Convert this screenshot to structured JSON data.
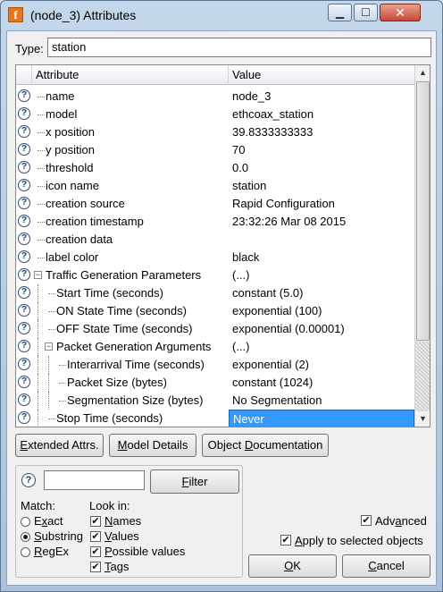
{
  "window": {
    "title": "(node_3) Attributes",
    "app_icon_letter": "f"
  },
  "type_field": {
    "label": "Type:",
    "value": "station"
  },
  "table": {
    "columns": [
      "Attribute",
      "Value"
    ],
    "rows": [
      {
        "attr": "name",
        "value": "node_3"
      },
      {
        "attr": "model",
        "value": "ethcoax_station"
      },
      {
        "attr": "x position",
        "value": "39.8333333333"
      },
      {
        "attr": "y position",
        "value": "70"
      },
      {
        "attr": "threshold",
        "value": "0.0"
      },
      {
        "attr": "icon name",
        "value": "station"
      },
      {
        "attr": "creation source",
        "value": "Rapid Configuration"
      },
      {
        "attr": "creation timestamp",
        "value": "23:32:26 Mar 08 2015"
      },
      {
        "attr": "creation data",
        "value": ""
      },
      {
        "attr": "label color",
        "value": "black"
      },
      {
        "attr": "Traffic Generation Parameters",
        "value": "(...)"
      },
      {
        "attr": "Start Time (seconds)",
        "value": "constant (5.0)"
      },
      {
        "attr": "ON State Time (seconds)",
        "value": "exponential (100)"
      },
      {
        "attr": "OFF State Time (seconds)",
        "value": "exponential (0.00001)"
      },
      {
        "attr": "Packet Generation Arguments",
        "value": "(...)"
      },
      {
        "attr": "Interarrival Time (seconds)",
        "value": "exponential (2)"
      },
      {
        "attr": "Packet Size (bytes)",
        "value": "constant (1024)"
      },
      {
        "attr": "Segmentation Size (bytes)",
        "value": "No Segmentation"
      },
      {
        "attr": "Stop Time (seconds)",
        "value": "Never"
      }
    ]
  },
  "buttons": {
    "extended_prefix": "E",
    "extended_rest": "xtended Attrs.",
    "model_prefix": "M",
    "model_rest": "odel Details",
    "objdoc_prefix": "Object ",
    "objdoc_u": "D",
    "objdoc_rest": "ocumentation",
    "filter_u": "F",
    "filter_rest": "ilter",
    "ok_u": "O",
    "ok_rest": "K",
    "cancel_u": "C",
    "cancel_rest": "ancel"
  },
  "filter_panel": {
    "match_label": "Match:",
    "match_options": [
      {
        "pre": "E",
        "u": "x",
        "post": "act",
        "selected": false
      },
      {
        "pre": "",
        "u": "S",
        "post": "ubstring",
        "selected": true
      },
      {
        "pre": "",
        "u": "R",
        "post": "egEx",
        "selected": false
      }
    ],
    "look_in_label": "Look in:",
    "look_in_options": [
      {
        "pre": "",
        "u": "N",
        "post": "ames",
        "checked": true
      },
      {
        "pre": "",
        "u": "V",
        "post": "alues",
        "checked": true
      },
      {
        "pre": "",
        "u": "P",
        "post": "ossible values",
        "checked": true
      },
      {
        "pre": "",
        "u": "T",
        "post": "ags",
        "checked": true
      }
    ]
  },
  "options": {
    "advanced": {
      "pre": "Adv",
      "u": "a",
      "post": "nced",
      "checked": true
    },
    "apply_selected": {
      "pre": "",
      "u": "A",
      "post": "pply to selected objects",
      "checked": true
    }
  },
  "help_glyph": "?"
}
